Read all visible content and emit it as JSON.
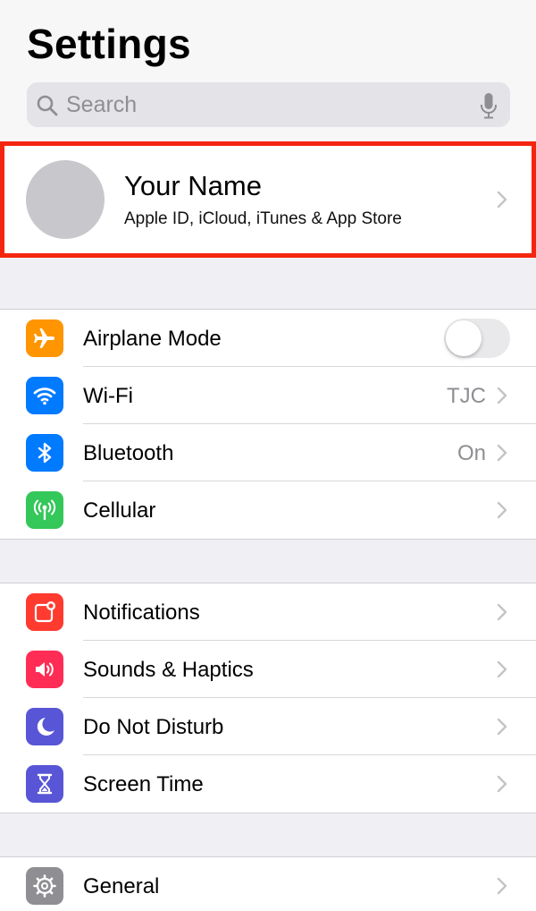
{
  "header": {
    "title": "Settings",
    "search_placeholder": "Search"
  },
  "profile": {
    "name": "Your Name",
    "subtitle": "Apple ID, iCloud, iTunes & App Store",
    "highlight_color": "#f4260f"
  },
  "group1": {
    "items": [
      {
        "label": "Airplane Mode",
        "icon": "airplane-icon",
        "color": "#ff9500",
        "toggle_on": false
      },
      {
        "label": "Wi-Fi",
        "icon": "wifi-icon",
        "color": "#007aff",
        "value": "TJC"
      },
      {
        "label": "Bluetooth",
        "icon": "bluetooth-icon",
        "color": "#007aff",
        "value": "On"
      },
      {
        "label": "Cellular",
        "icon": "cellular-icon",
        "color": "#34c759"
      }
    ]
  },
  "group2": {
    "items": [
      {
        "label": "Notifications",
        "icon": "notifications-icon",
        "color": "#ff3b30"
      },
      {
        "label": "Sounds & Haptics",
        "icon": "speaker-icon",
        "color": "#ff2d55"
      },
      {
        "label": "Do Not Disturb",
        "icon": "moon-icon",
        "color": "#5856d6"
      },
      {
        "label": "Screen Time",
        "icon": "hourglass-icon",
        "color": "#5856d6"
      }
    ]
  },
  "group3": {
    "items": [
      {
        "label": "General",
        "icon": "gear-icon",
        "color": "#8e8e93"
      }
    ]
  }
}
